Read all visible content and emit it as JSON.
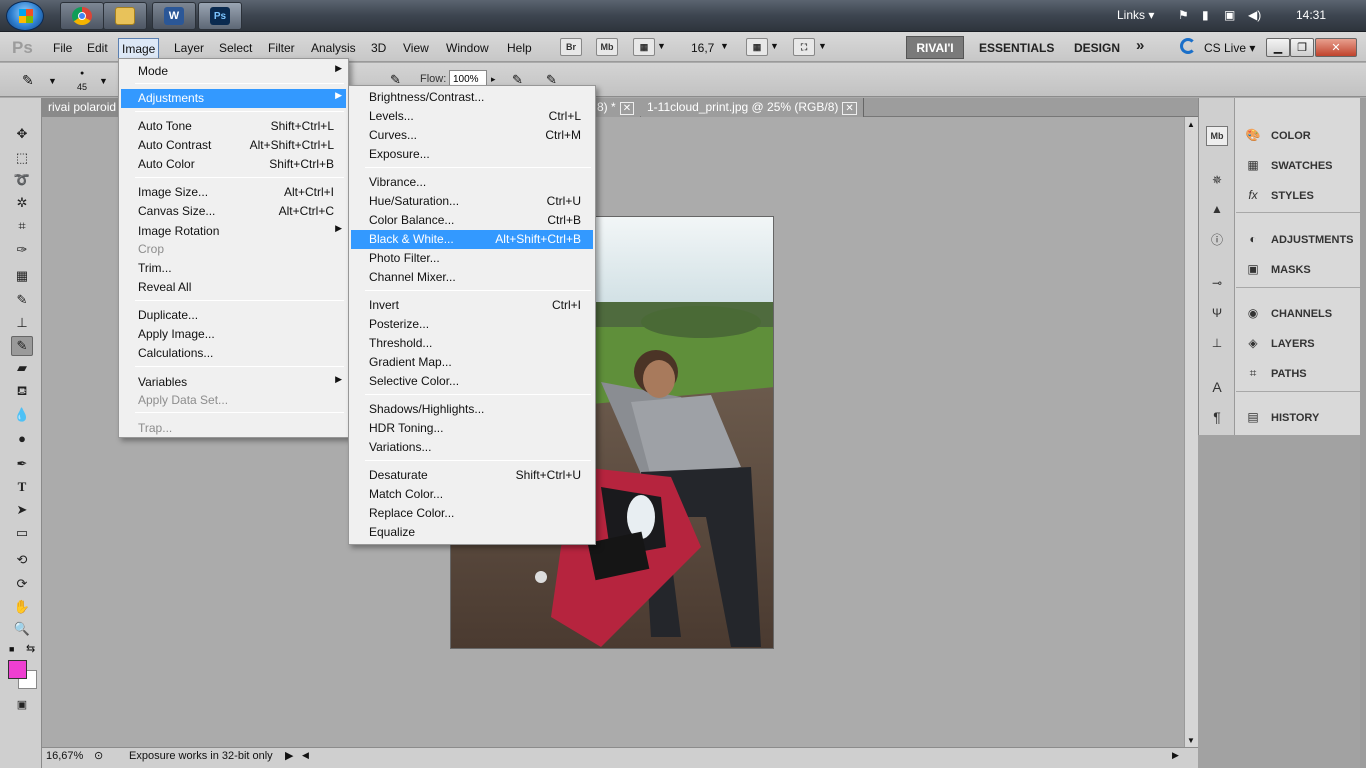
{
  "taskbar": {
    "apps": [
      "Chrome",
      "Explorer",
      "W",
      "Ps"
    ],
    "links_label": "Links",
    "clock": "14:31"
  },
  "menubar": {
    "logo": "Ps",
    "items": [
      "File",
      "Edit",
      "Image",
      "Layer",
      "Select",
      "Filter",
      "Analysis",
      "3D",
      "View",
      "Window",
      "Help"
    ],
    "bridge_icons": [
      "Br",
      "Mb"
    ],
    "zoom": "16,7",
    "workspaces": [
      "RIVAI'I",
      "ESSENTIALS",
      "DESIGN"
    ],
    "more": "»",
    "cs_live": "CS Live"
  },
  "options": {
    "brush_size": "45",
    "flow_label": "Flow:",
    "flow_value": "100%"
  },
  "tabs": [
    {
      "label": "rivai polaroid"
    },
    {
      "label": "8) *"
    },
    {
      "label": "1-11cloud_print.jpg @ 25% (RGB/8)"
    }
  ],
  "image_menu": {
    "items": [
      {
        "label": "Mode",
        "shortcut": "",
        "submenu": true
      },
      {
        "label": "Adjustments",
        "shortcut": "",
        "submenu": true,
        "highlight": true
      },
      {
        "label": "Auto Tone",
        "shortcut": "Shift+Ctrl+L"
      },
      {
        "label": "Auto Contrast",
        "shortcut": "Alt+Shift+Ctrl+L"
      },
      {
        "label": "Auto Color",
        "shortcut": "Shift+Ctrl+B"
      },
      {
        "label": "Image Size...",
        "shortcut": "Alt+Ctrl+I"
      },
      {
        "label": "Canvas Size...",
        "shortcut": "Alt+Ctrl+C"
      },
      {
        "label": "Image Rotation",
        "shortcut": "",
        "submenu": true
      },
      {
        "label": "Crop",
        "shortcut": "",
        "disabled": true
      },
      {
        "label": "Trim...",
        "shortcut": ""
      },
      {
        "label": "Reveal All",
        "shortcut": ""
      },
      {
        "label": "Duplicate...",
        "shortcut": ""
      },
      {
        "label": "Apply Image...",
        "shortcut": ""
      },
      {
        "label": "Calculations...",
        "shortcut": ""
      },
      {
        "label": "Variables",
        "shortcut": "",
        "submenu": true
      },
      {
        "label": "Apply Data Set...",
        "shortcut": "",
        "disabled": true
      },
      {
        "label": "Trap...",
        "shortcut": "",
        "disabled": true
      }
    ]
  },
  "adjustments_menu": {
    "items": [
      {
        "label": "Brightness/Contrast...",
        "shortcut": ""
      },
      {
        "label": "Levels...",
        "shortcut": "Ctrl+L"
      },
      {
        "label": "Curves...",
        "shortcut": "Ctrl+M"
      },
      {
        "label": "Exposure...",
        "shortcut": ""
      },
      {
        "label": "Vibrance...",
        "shortcut": ""
      },
      {
        "label": "Hue/Saturation...",
        "shortcut": "Ctrl+U"
      },
      {
        "label": "Color Balance...",
        "shortcut": "Ctrl+B"
      },
      {
        "label": "Black & White...",
        "shortcut": "Alt+Shift+Ctrl+B",
        "highlight": true
      },
      {
        "label": "Photo Filter...",
        "shortcut": ""
      },
      {
        "label": "Channel Mixer...",
        "shortcut": ""
      },
      {
        "label": "Invert",
        "shortcut": "Ctrl+I"
      },
      {
        "label": "Posterize...",
        "shortcut": ""
      },
      {
        "label": "Threshold...",
        "shortcut": ""
      },
      {
        "label": "Gradient Map...",
        "shortcut": ""
      },
      {
        "label": "Selective Color...",
        "shortcut": ""
      },
      {
        "label": "Shadows/Highlights...",
        "shortcut": ""
      },
      {
        "label": "HDR Toning...",
        "shortcut": ""
      },
      {
        "label": "Variations...",
        "shortcut": ""
      },
      {
        "label": "Desaturate",
        "shortcut": "Shift+Ctrl+U"
      },
      {
        "label": "Match Color...",
        "shortcut": ""
      },
      {
        "label": "Replace Color...",
        "shortcut": ""
      },
      {
        "label": "Equalize",
        "shortcut": ""
      }
    ]
  },
  "panels": {
    "group1": [
      "COLOR",
      "SWATCHES",
      "STYLES"
    ],
    "group2": [
      "ADJUSTMENTS",
      "MASKS"
    ],
    "group3": [
      "CHANNELS",
      "LAYERS",
      "PATHS"
    ],
    "group4": [
      "HISTORY"
    ]
  },
  "status": {
    "zoom": "16,67%",
    "text": "Exposure works in 32-bit only"
  },
  "colors": {
    "foreground": "#ee3fd1",
    "background": "#ffffff",
    "menu_highlight": "#3399ff"
  },
  "icons": [
    "start-orb-icon",
    "chrome-icon",
    "folder-icon",
    "word-icon",
    "photoshop-icon",
    "flag-icon",
    "battery-icon",
    "network-icon",
    "volume-icon",
    "move-tool-icon",
    "marquee-tool-icon",
    "lasso-tool-icon",
    "quick-select-icon",
    "crop-tool-icon",
    "eyedropper-icon",
    "healing-brush-icon",
    "brush-tool-icon",
    "clone-stamp-icon",
    "history-brush-icon",
    "eraser-icon",
    "paint-bucket-icon",
    "blur-tool-icon",
    "dodge-tool-icon",
    "pen-tool-icon",
    "type-tool-icon",
    "path-select-icon",
    "shape-tool-icon",
    "3d-rotate-icon",
    "3d-orbit-icon",
    "hand-tool-icon",
    "zoom-tool-icon",
    "quick-mask-icon"
  ]
}
